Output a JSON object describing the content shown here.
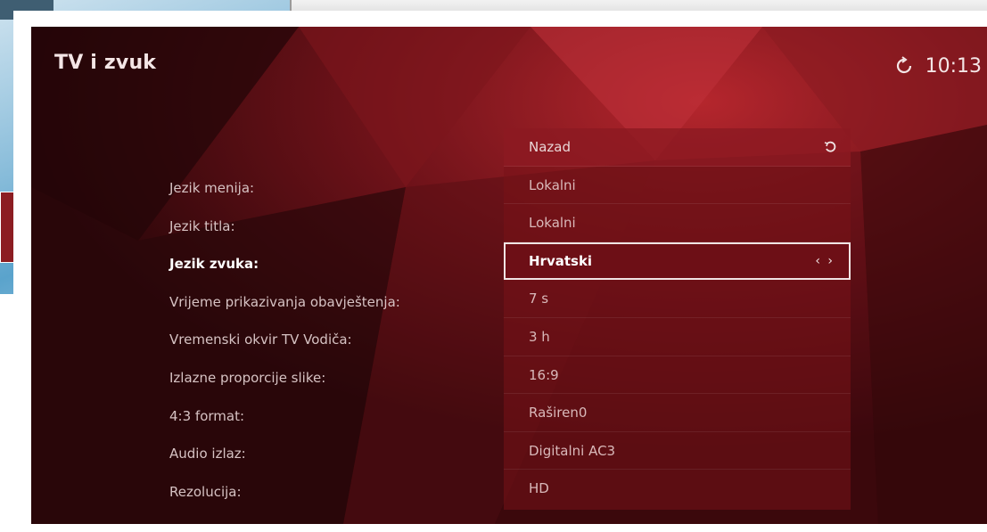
{
  "screen": {
    "title": "TV i zvuk",
    "time": "10:13"
  },
  "settings": [
    {
      "label": "Jezik menija:",
      "value": "Lokalni"
    },
    {
      "label": "Jezik titla:",
      "value": "Lokalni"
    },
    {
      "label": "Jezik zvuka:",
      "value": "Hrvatski"
    },
    {
      "label": "Vrijeme prikazivanja obavještenja:",
      "value": "7 s"
    },
    {
      "label": "Vremenski okvir TV Vodiča:",
      "value": "3 h"
    },
    {
      "label": "Izlazne proporcije slike:",
      "value": "16:9"
    },
    {
      "label": "4:3 format:",
      "value": "Raširen0"
    },
    {
      "label": "Audio izlaz:",
      "value": "Digitalni AC3"
    },
    {
      "label": "Rezolucija:",
      "value": "HD"
    }
  ],
  "dropdown": {
    "back_label": "Nazad",
    "selected_index": 2
  },
  "icons": {
    "clock": "refresh-clock-icon",
    "back": "back-arrow-icon",
    "selector": "left-right-arrows-icon"
  },
  "colors": {
    "background": "#4a0d12",
    "panel": "#78121a",
    "selected_border": "#f0e4e4"
  }
}
